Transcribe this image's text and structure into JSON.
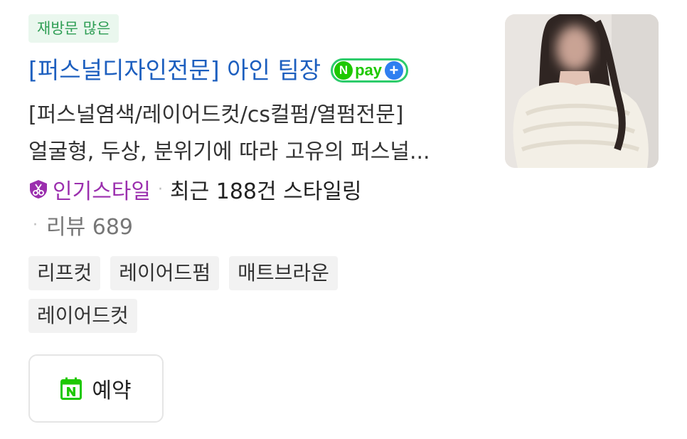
{
  "badge": "재방문 많은",
  "title": "[퍼스널디자인전문] 아인 팀장",
  "npay": {
    "n": "N",
    "text": "pay",
    "plus": "+",
    "icon": "npay-plus-icon"
  },
  "description": {
    "line1": "[퍼스널염색/레이어드컷/cs컬펌/열펌전문]",
    "line2": "얼굴형, 두상, 분위기에 따라 고유의 퍼스널..."
  },
  "stats": {
    "popular_label": "인기스타일",
    "popular_icon": "scissors-shield-icon",
    "separator": "·",
    "recent_styling": "최근 188건 스타일링",
    "reviews": "리뷰 689"
  },
  "tags": [
    "리프컷",
    "레이어드펌",
    "매트브라운",
    "레이어드컷"
  ],
  "reserve_button": {
    "label": "예약",
    "icon": "naver-calendar-icon"
  },
  "colors": {
    "title": "#1d5fbf",
    "badge_text": "#2f9e55",
    "badge_bg": "#eaf7ee",
    "popular": "#9b2fae",
    "npay_green": "#1ec800",
    "npay_blue": "#2f7ff0"
  }
}
